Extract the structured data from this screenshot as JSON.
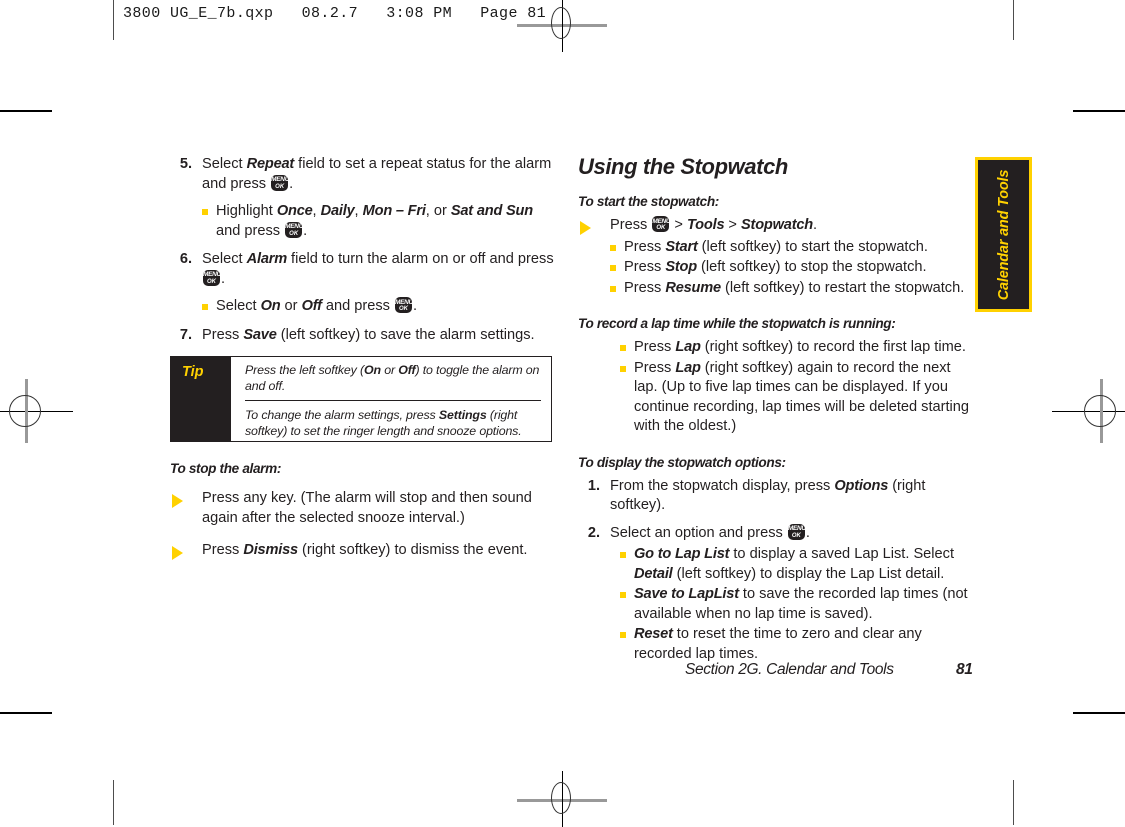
{
  "print_marks": {
    "slug": "3800 UG_E_7b.qxp   08.2.7   3:08 PM   Page 81"
  },
  "left_column": {
    "steps": [
      {
        "num": "5.",
        "text_parts": [
          "Select ",
          "Repeat",
          " field to set a repeat status for the alarm and press ",
          "MENU/OK",
          "."
        ],
        "subs": [
          {
            "text_parts": [
              "Highlight ",
              "Once",
              ", ",
              "Daily",
              ", ",
              "Mon – Fri",
              ", or ",
              "Sat and Sun",
              " and press ",
              "MENU/OK",
              "."
            ]
          }
        ]
      },
      {
        "num": "6.",
        "text_parts": [
          "Select ",
          "Alarm",
          " field to turn the alarm on or off and press ",
          "MENU/OK",
          "."
        ],
        "subs": [
          {
            "text_parts": [
              "Select ",
              "On",
              " or ",
              "Off",
              " and press ",
              "MENU/OK",
              "."
            ]
          }
        ]
      },
      {
        "num": "7.",
        "text_parts": [
          "Press ",
          "Save",
          " (left softkey) to save the alarm settings."
        ],
        "subs": []
      }
    ],
    "tip": {
      "label": "Tip",
      "paragraph_1": {
        "p1": "Press the left softkey (",
        "bold1": "On",
        "p2": " or ",
        "bold2": "Off",
        "p3": ") to toggle the alarm on and off."
      },
      "paragraph_2": {
        "p1": "To change the alarm settings, press ",
        "bold1": "Settings",
        "p2": " (right softkey) to set the ringer length and snooze options."
      }
    },
    "stop_alarm": {
      "heading": "To stop the alarm:",
      "items": [
        {
          "text": "Press any key. (The alarm will stop and then sound again after the selected snooze interval.)"
        },
        {
          "p1": "Press ",
          "em": "Dismiss",
          "p2": " (right softkey) to dismiss the event."
        }
      ]
    }
  },
  "right_column": {
    "section_title": "Using the Stopwatch",
    "start": {
      "heading": "To start the stopwatch:",
      "arrow": {
        "p1": "Press ",
        "key": "MENU/OK",
        "p2": " > ",
        "em1": "Tools",
        "p3": " > ",
        "em2": "Stopwatch",
        "p4": "."
      },
      "subs": [
        {
          "p1": "Press ",
          "em": "Start",
          "p2": " (left softkey) to start the stopwatch."
        },
        {
          "p1": "Press ",
          "em": "Stop",
          "p2": " (left softkey) to stop the stopwatch."
        },
        {
          "p1": "Press ",
          "em": "Resume",
          "p2": " (left softkey) to restart the stopwatch."
        }
      ]
    },
    "lap": {
      "heading": "To record a lap time while the stopwatch is running:",
      "subs": [
        {
          "p1": "Press ",
          "em": "Lap",
          "p2": " (right softkey) to record the first lap time."
        },
        {
          "p1": "Press ",
          "em": "Lap",
          "p2": " (right softkey) again to record the next lap. (Up to five lap times can be displayed. If you continue recording, lap times will be deleted starting with the oldest.)"
        }
      ]
    },
    "options": {
      "heading": "To display the stopwatch options:",
      "steps": [
        {
          "num": "1.",
          "p1": "From the stopwatch display, press ",
          "em": "Options",
          "p2": " (right softkey).",
          "subs": []
        },
        {
          "num": "2.",
          "p1": "Select an option and press ",
          "key": "MENU/OK",
          "p2": ".",
          "subs": [
            {
              "em": "Go to Lap List",
              "p1": " to display a saved Lap List. Select ",
              "em2": "Detail",
              "p2": " (left softkey) to display the Lap List detail."
            },
            {
              "em": "Save to LapList",
              "p1": " to save the recorded lap times (not available when no lap time is saved)."
            },
            {
              "em": "Reset",
              "p1": " to reset the time to zero and clear any recorded lap times."
            }
          ]
        }
      ]
    }
  },
  "side_tab": {
    "label": "Calendar and Tools"
  },
  "footer": {
    "section": "Section 2G. Calendar and Tools",
    "page": "81"
  },
  "colors": {
    "accent_yellow": "#FFD100",
    "ink": "#231f20",
    "tip_panel": "#231f20"
  }
}
